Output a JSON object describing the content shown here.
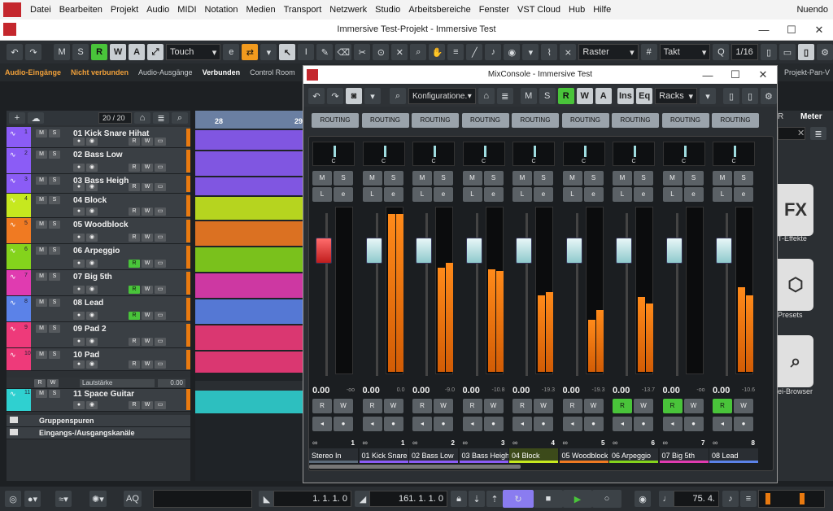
{
  "os_menu": {
    "items": [
      "Datei",
      "Bearbeiten",
      "Projekt",
      "Audio",
      "MIDI",
      "Notation",
      "Medien",
      "Transport",
      "Netzwerk",
      "Studio",
      "Arbeitsbereiche",
      "Fenster",
      "VST Cloud",
      "Hub",
      "Hilfe"
    ],
    "right": "Nuendo"
  },
  "project_window": {
    "title": "Immersive Test-Projekt - Immersive Test"
  },
  "toolbar": {
    "btn_m": "M",
    "btn_s": "S",
    "btn_r": "R",
    "btn_w": "W",
    "btn_a": "A",
    "automation_mode": "Touch",
    "grid": "Raster",
    "grid_type": "Takt",
    "quantize": "1/16"
  },
  "routing_bar": {
    "audio_inputs": "Audio-Eingänge",
    "not_connected": "Nicht verbunden",
    "audio_outputs": "Audio-Ausgänge",
    "connected": "Verbunden",
    "control_room": "Control Room",
    "ve": "Ve",
    "right_tab": "Projekt-Pan-V"
  },
  "tracklist": {
    "count": "20 / 20",
    "tracks": [
      {
        "num": "1",
        "name": "01 Kick Snare Hihat",
        "color": "#8b5cf6"
      },
      {
        "num": "2",
        "name": "02 Bass Low",
        "color": "#8b5cf6"
      },
      {
        "num": "3",
        "name": "03 Bass Heigh",
        "color": "#8b5cf6"
      },
      {
        "num": "4",
        "name": "04 Block",
        "color": "#c6e81f"
      },
      {
        "num": "5",
        "name": "05 Woodblock",
        "color": "#f07a22"
      },
      {
        "num": "6",
        "name": "06 Arpeggio",
        "color": "#84d31c"
      },
      {
        "num": "7",
        "name": "07 Big 5th",
        "color": "#e03bb0"
      },
      {
        "num": "8",
        "name": "08 Lead",
        "color": "#5b82e8"
      },
      {
        "num": "9",
        "name": "09 Pad 2",
        "color": "#ee3a7a"
      },
      {
        "num": "10",
        "name": "10 Pad",
        "color": "#ee3a7a"
      },
      {
        "num": "11",
        "name": "11 Space Guitar",
        "color": "#2fd0d0"
      }
    ],
    "automation_label": "Lautstärke",
    "automation_value": "0.00",
    "group_tracks": "Gruppenspuren",
    "io_channels": "Eingangs-/Ausgangskanäle",
    "bar_28": "28",
    "bar_29": "29"
  },
  "mixconsole": {
    "title": "MixConsole - Immersive Test",
    "configurations": "Konfiguratione.",
    "ins": "Ins",
    "eq": "Eq",
    "racks": "Racks",
    "routing_label": "ROUTING",
    "pan_center": "C",
    "channels": [
      {
        "name": "Stereo In",
        "num": "1",
        "vol": "0.00",
        "peak": "-oo",
        "meter": [
          0,
          0
        ],
        "color": "#5c6b7a",
        "r": false,
        "fader_red": true
      },
      {
        "name": "01 Kick Snare",
        "num": "1",
        "vol": "0.00",
        "peak": "0.0",
        "meter": [
          0.97,
          0.97
        ],
        "color": "#8b5cf6",
        "r": false
      },
      {
        "name": "02 Bass Low",
        "num": "2",
        "vol": "0.00",
        "peak": "-9.0",
        "meter": [
          0.64,
          0.67
        ],
        "color": "#8b5cf6",
        "r": false
      },
      {
        "name": "03 Bass Heigh",
        "num": "3",
        "vol": "0.00",
        "peak": "-10.8",
        "meter": [
          0.63,
          0.62
        ],
        "color": "#8b5cf6",
        "r": false
      },
      {
        "name": "04 Block",
        "num": "4",
        "vol": "0.00",
        "peak": "-19.3",
        "meter": [
          0.47,
          0.49
        ],
        "color": "#c6e81f",
        "r": false
      },
      {
        "name": "05 Woodblock",
        "num": "5",
        "vol": "0.00",
        "peak": "-19.3",
        "meter": [
          0.32,
          0.38
        ],
        "color": "#f07a22",
        "r": false
      },
      {
        "name": "06 Arpeggio",
        "num": "6",
        "vol": "0.00",
        "peak": "-13.7",
        "meter": [
          0.46,
          0.42
        ],
        "color": "#84d31c",
        "r": true
      },
      {
        "name": "07 Big 5th",
        "num": "7",
        "vol": "0.00",
        "peak": "-oo",
        "meter": [
          0,
          0
        ],
        "color": "#e03bb0",
        "r": true
      },
      {
        "name": "08 Lead",
        "num": "8",
        "vol": "0.00",
        "peak": "-10.6",
        "meter": [
          0.52,
          0.47
        ],
        "color": "#5b82e8",
        "r": true
      }
    ]
  },
  "right_panel": {
    "tab_r": "R",
    "tab_meter": "Meter",
    "fx_label": "T-Effekte",
    "presets_label": "Presets",
    "browser_label": "ei-Browser",
    "fx_tile": "FX"
  },
  "transport": {
    "aq": "AQ",
    "left_locator": "1. 1. 1.   0",
    "right_locator": "161. 1. 1.   0",
    "tempo": "75. 4."
  }
}
